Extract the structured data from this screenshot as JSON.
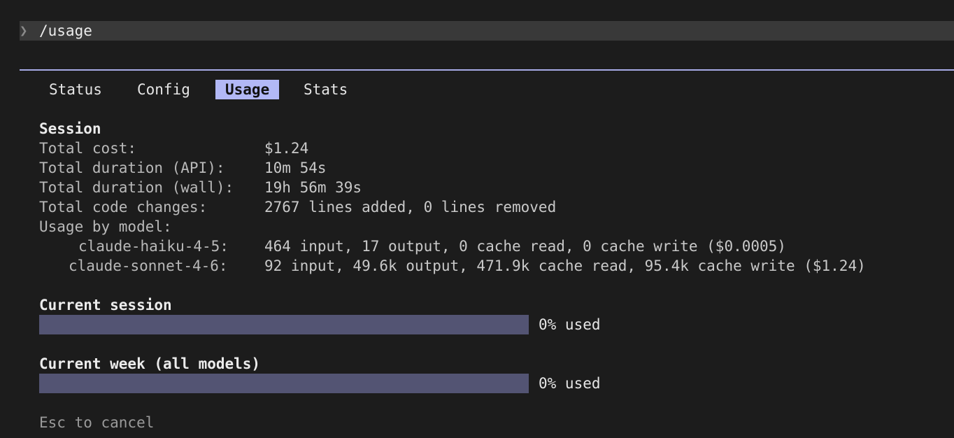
{
  "prompt": {
    "chevron": "❯",
    "command": "/usage"
  },
  "tabs": [
    {
      "label": "Status",
      "active": false
    },
    {
      "label": "Config",
      "active": false
    },
    {
      "label": "Usage",
      "active": true
    },
    {
      "label": "Stats",
      "active": false
    }
  ],
  "session": {
    "heading": "Session",
    "rows": [
      {
        "label": "Total cost:",
        "value": "$1.24"
      },
      {
        "label": "Total duration (API):",
        "value": "10m 54s"
      },
      {
        "label": "Total duration (wall):",
        "value": "19h 56m 39s"
      },
      {
        "label": "Total code changes:",
        "value": "2767 lines added, 0 lines removed"
      }
    ],
    "usage_by_model_label": "Usage by model:",
    "models": [
      {
        "name": "claude-haiku-4-5:",
        "value": "464 input, 17 output, 0 cache read, 0 cache write ($0.0005)"
      },
      {
        "name": "claude-sonnet-4-6:",
        "value": "92 input, 49.6k output, 471.9k cache read, 95.4k cache write ($1.24)"
      }
    ]
  },
  "limits": [
    {
      "heading": "Current session",
      "used_percent": 0,
      "label": "0% used"
    },
    {
      "heading": "Current week (all models)",
      "used_percent": 0,
      "label": "0% used"
    }
  ],
  "footer": {
    "hint": "Esc to cancel"
  },
  "colors": {
    "background": "#1c1c1c",
    "accent": "#b2b8f6",
    "bar_track": "#535473",
    "prompt_bar": "#393939"
  }
}
